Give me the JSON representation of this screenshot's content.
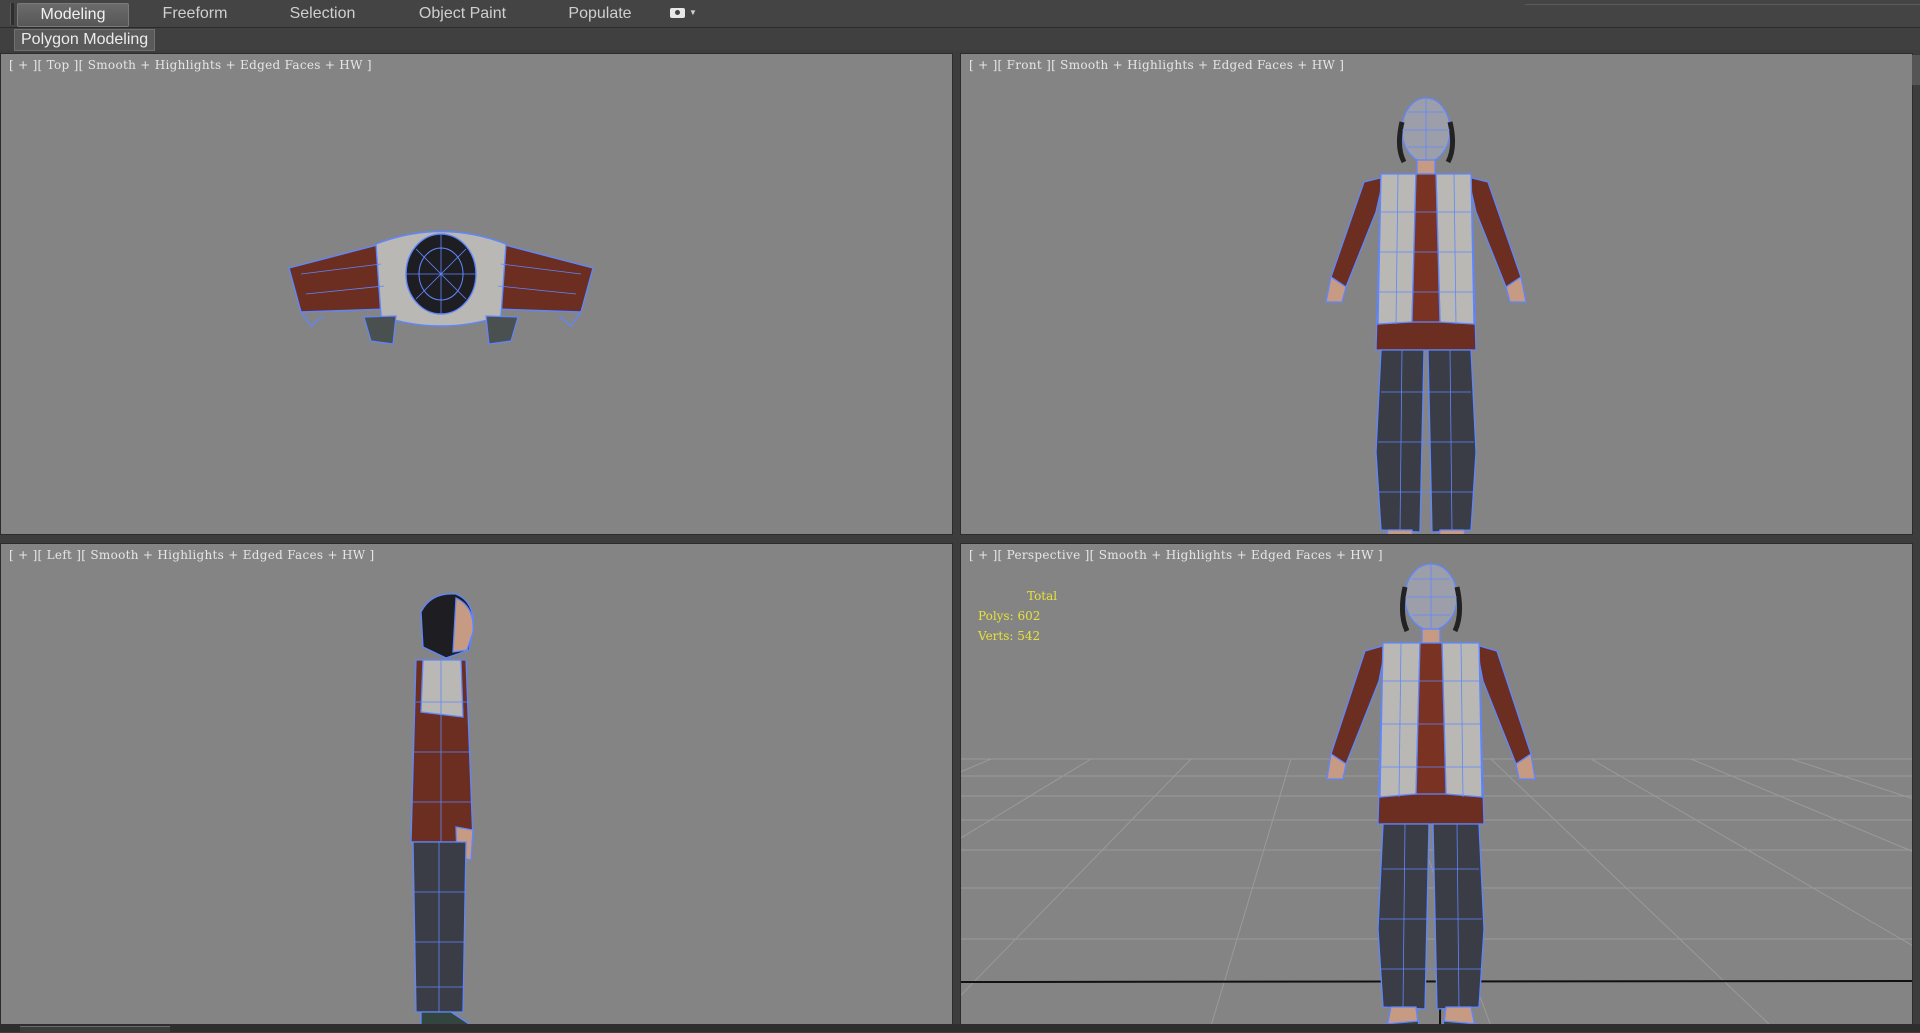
{
  "ribbon": {
    "tabs": [
      "Modeling",
      "Freeform",
      "Selection",
      "Object Paint",
      "Populate"
    ],
    "active_tab": "Modeling"
  },
  "subbar": {
    "label": "Polygon Modeling"
  },
  "viewports": {
    "top": {
      "label": "[ + ][ Top ][ Smooth + Highlights + Edged Faces + HW ]"
    },
    "front": {
      "label": "[ + ][ Front ][ Smooth + Highlights + Edged Faces + HW ]"
    },
    "left": {
      "label": "[ + ][ Left ][ Smooth + Highlights + Edged Faces + HW ]"
    },
    "perspective": {
      "label": "[ + ][ Perspective ][ Smooth + Highlights + Edged Faces + HW ]",
      "stats": {
        "header": "Total",
        "polys": "Polys: 602",
        "verts": "Verts: 542"
      }
    }
  },
  "colors": {
    "viewport_bg": "#848484",
    "wire": "#5f86ff",
    "jacket": "#6b2e20",
    "vest": "#b9b8b4",
    "pants": "#3a3d45",
    "skin": "#c79a84",
    "stats_text": "#e6e23a"
  }
}
